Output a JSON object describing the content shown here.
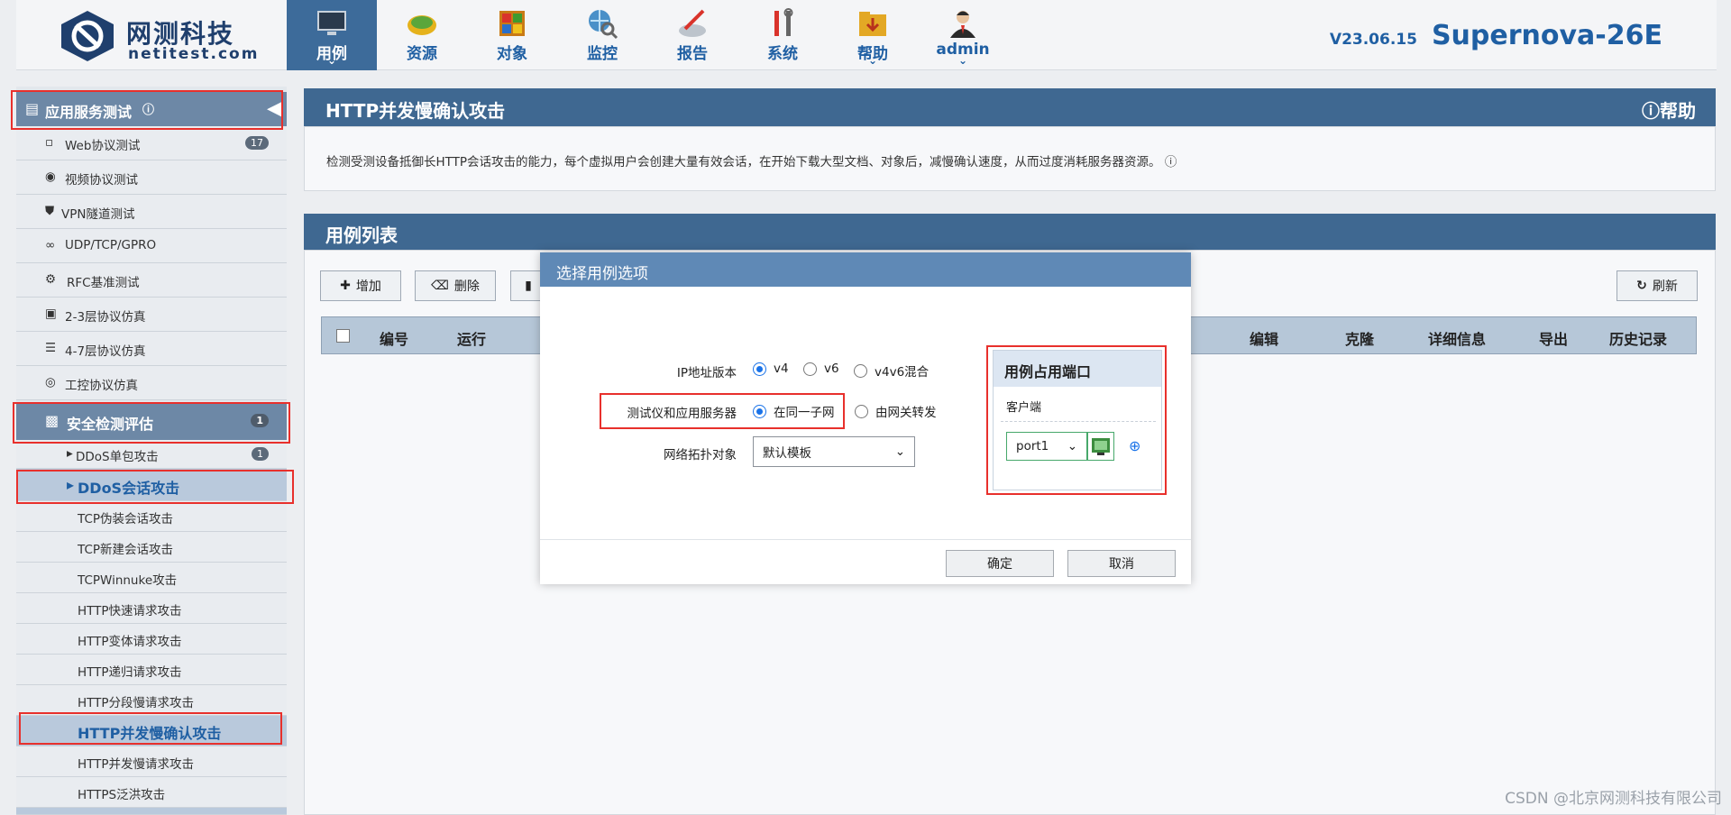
{
  "brand": {
    "name_cn": "网测科技",
    "name_en": "netitest.com"
  },
  "nav": [
    {
      "label": "用例",
      "icon": "monitor-icon",
      "active": true,
      "caret": true
    },
    {
      "label": "资源",
      "icon": "resource-icon"
    },
    {
      "label": "对象",
      "icon": "windows-icon"
    },
    {
      "label": "监控",
      "icon": "globe-monitor-icon"
    },
    {
      "label": "报告",
      "icon": "report-icon"
    },
    {
      "label": "系统",
      "icon": "tools-icon"
    },
    {
      "label": "帮助",
      "icon": "folder-help-icon",
      "caret": true
    },
    {
      "label": "admin",
      "icon": "user-avatar-icon",
      "caret": true
    }
  ],
  "version": "V23.06.15",
  "model": "Supernova-26E",
  "sidebar": {
    "section1": "应用服务测试",
    "items": [
      {
        "label": "Web协议测试",
        "badge": "17"
      },
      {
        "label": "视频协议测试"
      },
      {
        "label": "VPN隧道测试"
      },
      {
        "label": "UDP/TCP/GPRO"
      },
      {
        "label": "RFC基准测试"
      },
      {
        "label": "2-3层协议仿真"
      },
      {
        "label": "4-7层协议仿真"
      },
      {
        "label": "工控协议仿真"
      }
    ],
    "section2": "安全检测评估",
    "section2_badge": "1",
    "sub": [
      {
        "label": "DDoS单包攻击",
        "badge": "1"
      },
      {
        "label": "DDoS会话攻击"
      }
    ],
    "leaves": [
      "TCP伪装会话攻击",
      "TCP新建会话攻击",
      "TCPWinnuke攻击",
      "HTTP快速请求攻击",
      "HTTP变体请求攻击",
      "HTTP递归请求攻击",
      "HTTP分段慢请求攻击",
      "HTTP并发慢确认攻击",
      "HTTP并发慢请求攻击",
      "HTTPS泛洪攻击"
    ]
  },
  "main": {
    "title": "HTTP并发慢确认攻击",
    "help": "帮助",
    "description": "检测受测设备抵御长HTTP会话攻击的能力，每个虚拟用户会创建大量有效会话，在开始下载大型文档、对象后，减慢确认速度，从而过度消耗服务器资源。",
    "list_title": "用例列表",
    "buttons": {
      "add": "增加",
      "delete": "删除",
      "refresh": "刷新"
    },
    "columns": [
      "编号",
      "运行",
      "编辑",
      "克隆",
      "详细信息",
      "导出",
      "历史记录"
    ]
  },
  "modal": {
    "title": "选择用例选项",
    "ip_label": "IP地址版本",
    "ip_options": [
      "v4",
      "v6",
      "v4v6混合"
    ],
    "ip_selected": "v4",
    "server_label": "测试仪和应用服务器",
    "server_options": [
      "在同一子网",
      "由网关转发"
    ],
    "server_selected": "在同一子网",
    "topo_label": "网络拓扑对象",
    "topo_value": "默认模板",
    "ports_title": "用例占用端口",
    "client_label": "客户端",
    "port_value": "port1",
    "ok": "确定",
    "cancel": "取消"
  },
  "watermark": "CSDN @北京网测科技有限公司",
  "colors": {
    "accent": "#3f6891",
    "highlight": "#e8302c",
    "nav_text": "#1f5fa3"
  }
}
